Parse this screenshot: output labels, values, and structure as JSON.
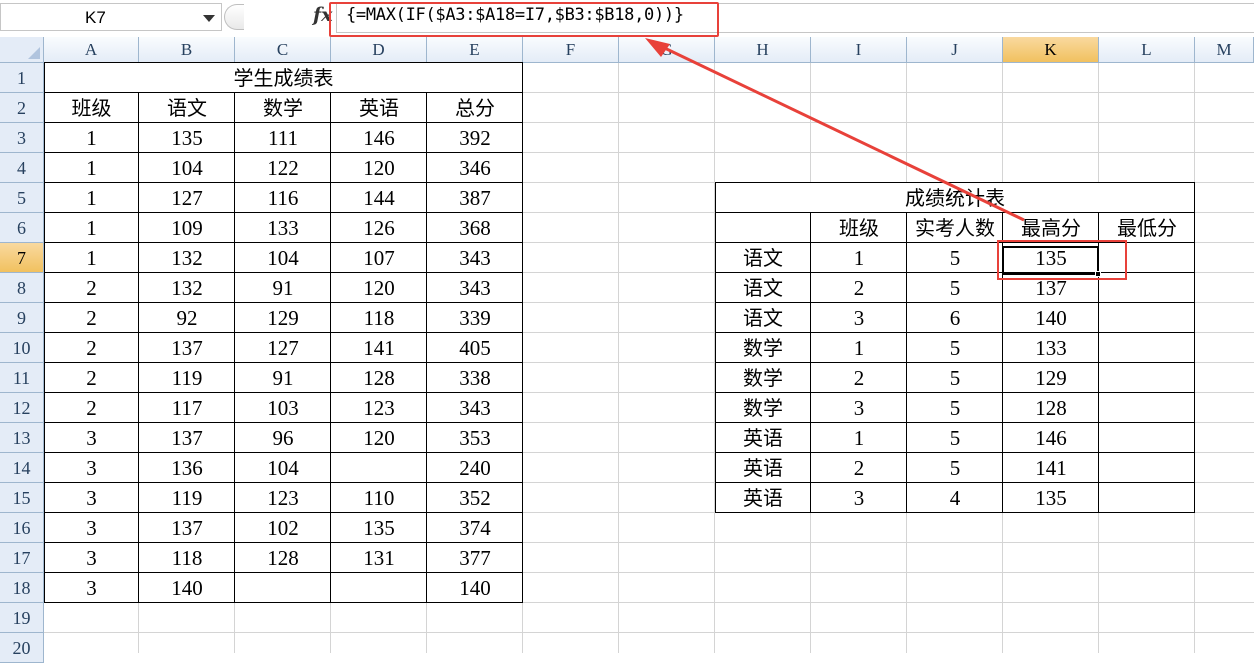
{
  "formula_bar": {
    "name_box": "K7",
    "formula": "{=MAX(IF($A3:$A18=I7,$B3:$B18,0))}",
    "fx_icon": "function-fx-icon"
  },
  "columns": [
    "A",
    "B",
    "C",
    "D",
    "E",
    "F",
    "G",
    "H",
    "I",
    "J",
    "K",
    "L",
    "M"
  ],
  "rows": [
    "1",
    "2",
    "3",
    "4",
    "5",
    "6",
    "7",
    "8",
    "9",
    "10",
    "11",
    "12",
    "13",
    "14",
    "15",
    "16",
    "17",
    "18",
    "19",
    "20"
  ],
  "active_cell": {
    "column": "K",
    "row": "7"
  },
  "table1": {
    "title": "学生成绩表",
    "headers": [
      "班级",
      "语文",
      "数学",
      "英语",
      "总分"
    ],
    "rows": [
      [
        "1",
        "135",
        "111",
        "146",
        "392"
      ],
      [
        "1",
        "104",
        "122",
        "120",
        "346"
      ],
      [
        "1",
        "127",
        "116",
        "144",
        "387"
      ],
      [
        "1",
        "109",
        "133",
        "126",
        "368"
      ],
      [
        "1",
        "132",
        "104",
        "107",
        "343"
      ],
      [
        "2",
        "132",
        "91",
        "120",
        "343"
      ],
      [
        "2",
        "92",
        "129",
        "118",
        "339"
      ],
      [
        "2",
        "137",
        "127",
        "141",
        "405"
      ],
      [
        "2",
        "119",
        "91",
        "128",
        "338"
      ],
      [
        "2",
        "117",
        "103",
        "123",
        "343"
      ],
      [
        "3",
        "137",
        "96",
        "120",
        "353"
      ],
      [
        "3",
        "136",
        "104",
        "",
        "240"
      ],
      [
        "3",
        "119",
        "123",
        "110",
        "352"
      ],
      [
        "3",
        "137",
        "102",
        "135",
        "374"
      ],
      [
        "3",
        "118",
        "128",
        "131",
        "377"
      ],
      [
        "3",
        "140",
        "",
        "",
        "140"
      ]
    ]
  },
  "table2": {
    "title": "成绩统计表",
    "headers": [
      "",
      "班级",
      "实考人数",
      "最高分",
      "最低分"
    ],
    "rows": [
      [
        "语文",
        "1",
        "5",
        "135",
        ""
      ],
      [
        "语文",
        "2",
        "5",
        "137",
        ""
      ],
      [
        "语文",
        "3",
        "6",
        "140",
        ""
      ],
      [
        "数学",
        "1",
        "5",
        "133",
        ""
      ],
      [
        "数学",
        "2",
        "5",
        "129",
        ""
      ],
      [
        "数学",
        "3",
        "5",
        "128",
        ""
      ],
      [
        "英语",
        "1",
        "5",
        "146",
        ""
      ],
      [
        "英语",
        "2",
        "5",
        "141",
        ""
      ],
      [
        "英语",
        "3",
        "4",
        "135",
        ""
      ]
    ]
  },
  "annotation_color": "#e8413a"
}
